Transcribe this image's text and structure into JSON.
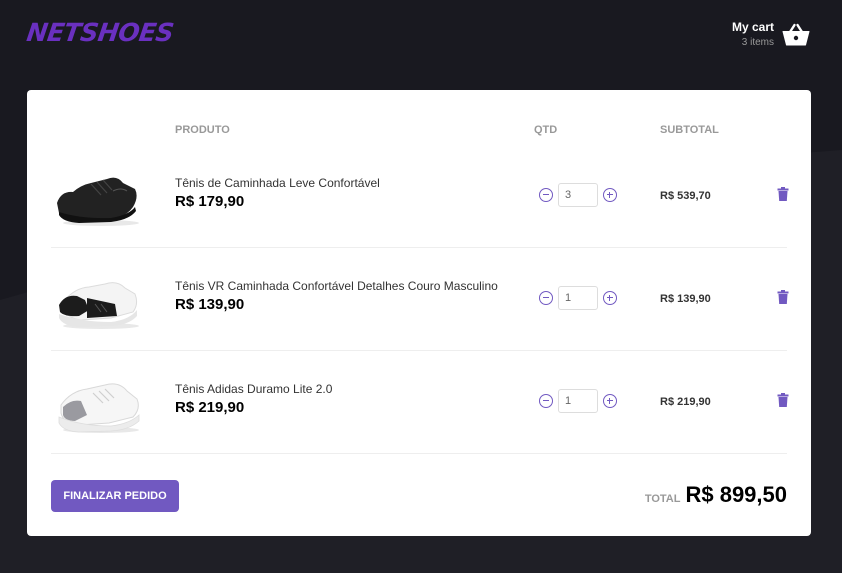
{
  "header": {
    "logo": "NETSHOES",
    "cart_title": "My cart",
    "cart_count": "3 items",
    "cart_icon": "basket-icon"
  },
  "table": {
    "col_product": "PRODUTO",
    "col_qty": "QTD",
    "col_subtotal": "SUBTOTAL"
  },
  "items": [
    {
      "title": "Tênis de Caminhada Leve Confortável",
      "price": "R$ 179,90",
      "qty": "3",
      "subtotal": "R$ 539,70"
    },
    {
      "title": "Tênis VR Caminhada Confortável Detalhes Couro Masculino",
      "price": "R$ 139,90",
      "qty": "1",
      "subtotal": "R$ 139,90"
    },
    {
      "title": "Tênis Adidas Duramo Lite 2.0",
      "price": "R$ 219,90",
      "qty": "1",
      "subtotal": "R$ 219,90"
    }
  ],
  "footer": {
    "finish_label": "FINALIZAR PEDIDO",
    "total_label": "TOTAL",
    "total_value": "R$ 899,50"
  },
  "colors": {
    "background": "#191920",
    "accent": "#7159c1",
    "logo": "#6a30c0"
  }
}
